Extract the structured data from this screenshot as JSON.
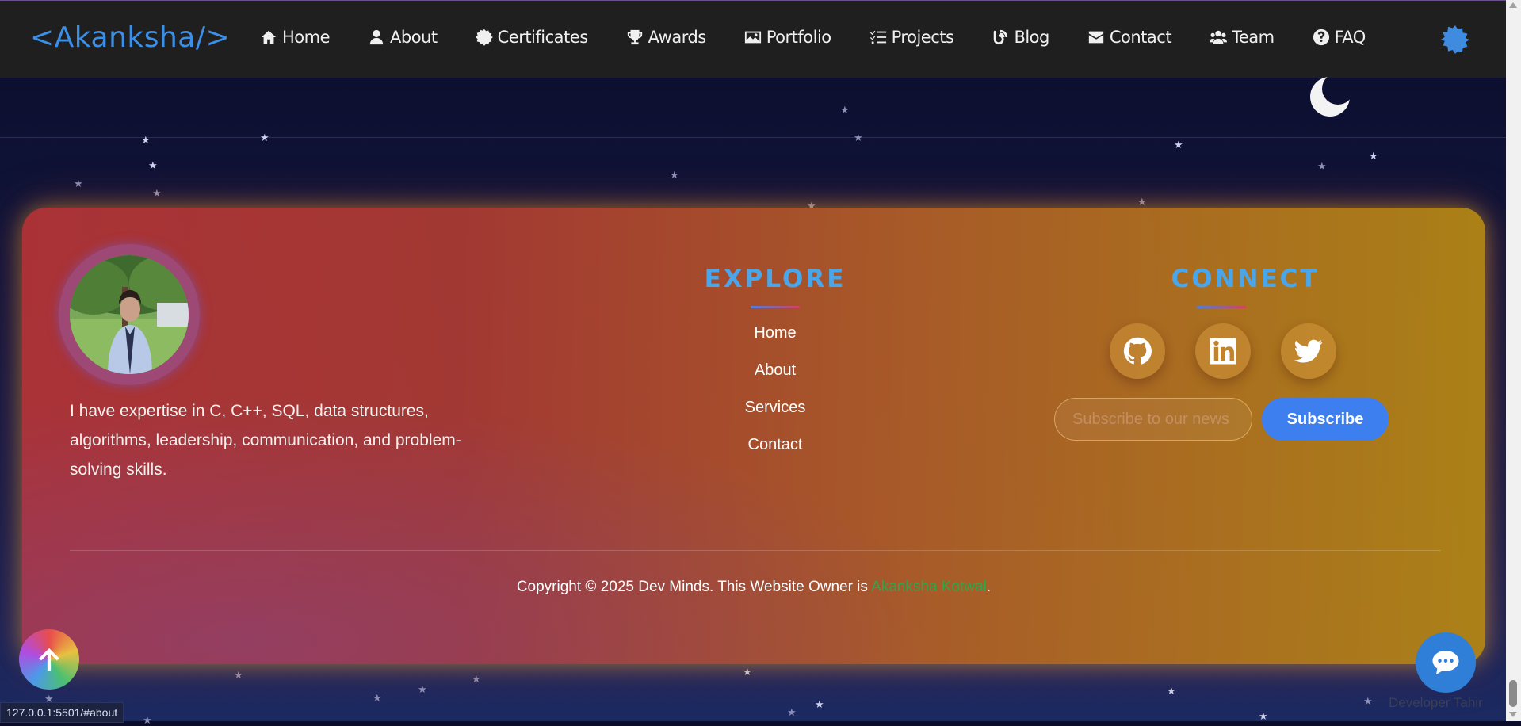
{
  "nav": {
    "logo": "<Akanksha/>",
    "items": [
      {
        "label": "Home",
        "icon": "home-icon"
      },
      {
        "label": "About",
        "icon": "user-icon"
      },
      {
        "label": "Certificates",
        "icon": "certificate-icon"
      },
      {
        "label": "Awards",
        "icon": "trophy-icon"
      },
      {
        "label": "Portfolio",
        "icon": "images-icon"
      },
      {
        "label": "Projects",
        "icon": "list-check-icon"
      },
      {
        "label": "Blog",
        "icon": "blog-icon"
      },
      {
        "label": "Contact",
        "icon": "envelope-icon"
      },
      {
        "label": "Team",
        "icon": "users-icon"
      },
      {
        "label": "FAQ",
        "icon": "question-circle-icon"
      }
    ],
    "theme_toggle_icon": "sun-gear-icon"
  },
  "footer": {
    "bio": "I have expertise in C, C++, SQL, data structures, algorithms, leadership, communication, and problem-solving skills.",
    "explore": {
      "title": "EXPLORE",
      "links": [
        "Home",
        "About",
        "Services",
        "Contact"
      ]
    },
    "connect": {
      "title": "CONNECT",
      "socials": [
        "github-icon",
        "linkedin-icon",
        "twitter-icon"
      ],
      "subscribe_placeholder": "Subscribe to our news",
      "subscribe_label": "Subscribe"
    },
    "copyright_prefix": "Copyright © 2025 Dev Minds. This Website Owner is ",
    "owner_name": "Akanksha Kotwal",
    "copyright_suffix": "."
  },
  "floating": {
    "scroll_top_icon": "arrow-up-icon",
    "chat_icon": "chat-icon",
    "developer_credit": "Developer Tahir"
  },
  "status_url": "127.0.0.1:5501/#about",
  "colors": {
    "accent": "#3b8fe6",
    "subscribe_button": "#3e7ff0",
    "owner_link": "#2da74a",
    "nav_bg": "#1f1f1f"
  }
}
